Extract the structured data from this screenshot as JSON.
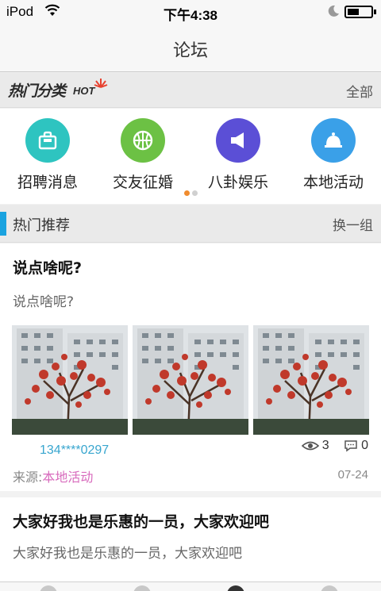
{
  "status_bar": {
    "carrier": "iPod",
    "time": "下午4:38"
  },
  "nav": {
    "title": "论坛"
  },
  "hot": {
    "logo_text": "热门分类",
    "logo_hot": "HOT",
    "all_label": "全部"
  },
  "categories": [
    {
      "label": "招聘消息",
      "color": "#2ec4c0",
      "icon": "briefcase-icon"
    },
    {
      "label": "交友征婚",
      "color": "#6cc144",
      "icon": "basketball-icon"
    },
    {
      "label": "八卦娱乐",
      "color": "#5b4fd6",
      "icon": "megaphone-icon"
    },
    {
      "label": "本地活动",
      "color": "#3aa0e8",
      "icon": "bell-icon"
    }
  ],
  "pager": {
    "pages": 2,
    "current": 1,
    "active_color": "#f08c2e",
    "inactive_color": "#d0d0d0"
  },
  "section": {
    "title": "热门推荐",
    "refresh_label": "换一组"
  },
  "posts": [
    {
      "title": "说点啥呢?",
      "body": "说点啥呢?",
      "author": "134****0297",
      "views": "3",
      "comments": "0",
      "source_prefix": "来源:",
      "source_category": "本地活动",
      "date": "07-24"
    },
    {
      "title": "大家好我也是乐惠的一员，大家欢迎吧",
      "body": "大家好我也是乐惠的一员，大家欢迎吧"
    }
  ]
}
